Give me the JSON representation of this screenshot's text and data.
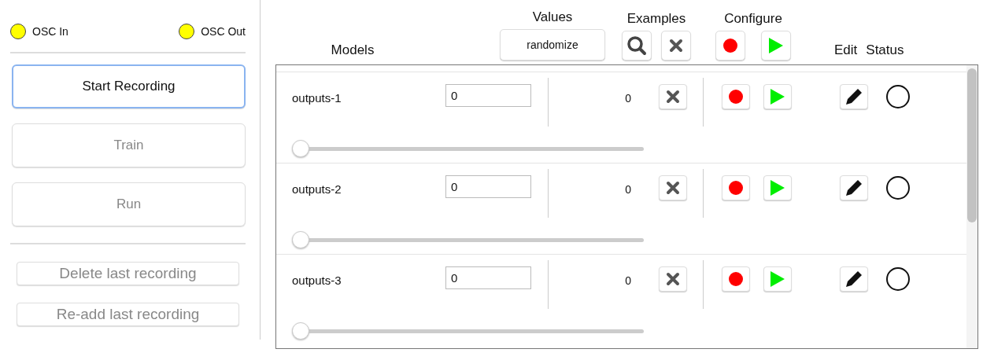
{
  "indicators": [
    {
      "label": "OSC In",
      "color": "#ffff00"
    },
    {
      "label": "OSC Out",
      "color": "#ffff00"
    }
  ],
  "main_buttons": [
    {
      "label": "Start Recording",
      "disabled": false,
      "focused": true
    },
    {
      "label": "Train",
      "disabled": true,
      "focused": false
    },
    {
      "label": "Run",
      "disabled": true,
      "focused": false
    }
  ],
  "secondary_buttons": [
    {
      "label": "Delete last recording",
      "disabled": true
    },
    {
      "label": "Re-add last recording",
      "disabled": true
    }
  ],
  "header": {
    "models_label": "Models",
    "values_label": "Values",
    "randomize_button": "randomize",
    "examples_label": "Examples",
    "configure_label": "Configure",
    "edit_label": "Edit",
    "status_label": "Status"
  },
  "models": [
    {
      "name": "outputs-1",
      "value": "0",
      "examples": "0",
      "level": 0
    },
    {
      "name": "outputs-2",
      "value": "0",
      "examples": "0",
      "level": 0
    },
    {
      "name": "outputs-3",
      "value": "0",
      "examples": "0",
      "level": 0
    }
  ]
}
